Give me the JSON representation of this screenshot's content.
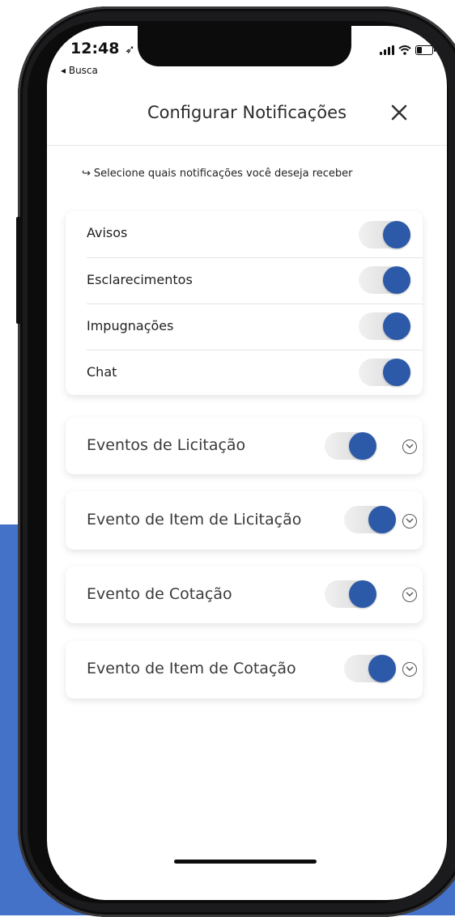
{
  "status_bar": {
    "time": "12:48",
    "location_glyph": "➶",
    "back_label": "◂ Busca"
  },
  "header": {
    "title": "Configurar Notificações",
    "close_icon": "close-icon"
  },
  "hint": {
    "arrow": "↪",
    "text": "Selecione quais notificações você deseja receber"
  },
  "notification_types": [
    {
      "label": "Avisos",
      "enabled": true
    },
    {
      "label": "Esclarecimentos",
      "enabled": true
    },
    {
      "label": "Impugnações",
      "enabled": true
    },
    {
      "label": "Chat",
      "enabled": true
    }
  ],
  "event_groups": [
    {
      "label": "Eventos de Licitação",
      "enabled": true,
      "expanded": false
    },
    {
      "label": "Evento de Item de Licitação",
      "enabled": true,
      "expanded": false
    },
    {
      "label": "Evento de Cotação",
      "enabled": true,
      "expanded": false
    },
    {
      "label": "Evento de Item de Cotação",
      "enabled": true,
      "expanded": false
    }
  ],
  "colors": {
    "accent": "#2d5aa8",
    "background_block": "#4472c9",
    "toggle_track": "#d5d5d7",
    "text": "#1f1f1f"
  }
}
